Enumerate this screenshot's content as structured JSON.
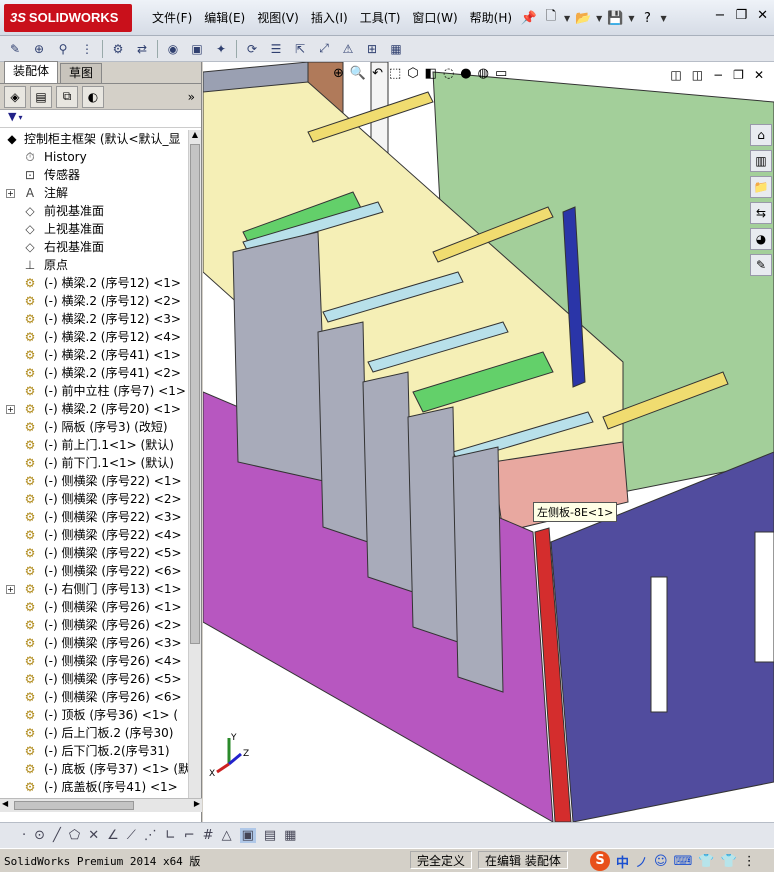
{
  "app": {
    "logo_text": "SOLIDWORKS",
    "logo_prefix": "3S",
    "menus": [
      "文件(F)",
      "编辑(E)",
      "视图(V)",
      "插入(I)",
      "工具(T)",
      "窗口(W)",
      "帮助(H)"
    ]
  },
  "panel": {
    "tabs": [
      "装配体",
      "草图"
    ],
    "active_tab": "装配体"
  },
  "tree": {
    "root": "控制柜主框架  (默认<默认_显",
    "items": [
      {
        "label": "History",
        "icon": "history-icon",
        "expandable": false
      },
      {
        "label": "传感器",
        "icon": "sensor-icon",
        "expandable": false
      },
      {
        "label": "注解",
        "icon": "annotation-icon",
        "expandable": true
      },
      {
        "label": "前视基准面",
        "icon": "plane-icon",
        "expandable": false
      },
      {
        "label": "上视基准面",
        "icon": "plane-icon",
        "expandable": false
      },
      {
        "label": "右视基准面",
        "icon": "plane-icon",
        "expandable": false
      },
      {
        "label": "原点",
        "icon": "origin-icon",
        "expandable": false
      },
      {
        "label": "(-) 横梁.2 (序号12) <1>",
        "icon": "part-icon",
        "expandable": false
      },
      {
        "label": "(-) 横梁.2 (序号12) <2>",
        "icon": "part-icon",
        "expandable": false
      },
      {
        "label": "(-) 横梁.2 (序号12) <3>",
        "icon": "part-icon",
        "expandable": false
      },
      {
        "label": "(-) 横梁.2 (序号12) <4>",
        "icon": "part-icon",
        "expandable": false
      },
      {
        "label": "(-) 横梁.2 (序号41) <1>",
        "icon": "part-icon",
        "expandable": false
      },
      {
        "label": "(-) 横梁.2 (序号41) <2>",
        "icon": "part-icon",
        "expandable": false
      },
      {
        "label": "(-) 前中立柱 (序号7) <1>",
        "icon": "part-icon",
        "expandable": false
      },
      {
        "label": "(-) 横梁.2 (序号20) <1>",
        "icon": "assembly-icon",
        "expandable": true
      },
      {
        "label": "(-) 隔板 (序号3) (改短)",
        "icon": "part-icon",
        "expandable": false
      },
      {
        "label": "(-) 前上门.1<1> (默认)",
        "icon": "part-icon",
        "expandable": false
      },
      {
        "label": "(-) 前下门.1<1> (默认)",
        "icon": "part-icon",
        "expandable": false
      },
      {
        "label": "(-) 侧横梁 (序号22) <1>",
        "icon": "part-icon",
        "expandable": false
      },
      {
        "label": "(-) 侧横梁 (序号22) <2>",
        "icon": "part-icon",
        "expandable": false
      },
      {
        "label": "(-) 侧横梁 (序号22) <3>",
        "icon": "part-icon",
        "expandable": false
      },
      {
        "label": "(-) 侧横梁 (序号22) <4>",
        "icon": "part-icon",
        "expandable": false
      },
      {
        "label": "(-) 侧横梁 (序号22) <5>",
        "icon": "part-icon",
        "expandable": false
      },
      {
        "label": "(-) 侧横梁 (序号22) <6>",
        "icon": "part-icon",
        "expandable": false
      },
      {
        "label": "(-) 右侧门 (序号13) <1>",
        "icon": "assembly-icon",
        "expandable": true
      },
      {
        "label": "(-) 侧横梁 (序号26) <1>",
        "icon": "part-icon",
        "expandable": false
      },
      {
        "label": "(-) 侧横梁 (序号26) <2>",
        "icon": "part-icon",
        "expandable": false
      },
      {
        "label": "(-) 侧横梁 (序号26) <3>",
        "icon": "part-icon",
        "expandable": false
      },
      {
        "label": "(-) 侧横梁 (序号26) <4>",
        "icon": "part-icon",
        "expandable": false
      },
      {
        "label": "(-) 侧横梁 (序号26) <5>",
        "icon": "part-icon",
        "expandable": false
      },
      {
        "label": "(-) 侧横梁 (序号26) <6>",
        "icon": "part-icon",
        "expandable": false
      },
      {
        "label": "(-) 顶板 (序号36) <1> (",
        "icon": "part-icon",
        "expandable": false
      },
      {
        "label": "(-) 后上门板.2 (序号30)",
        "icon": "part-icon",
        "expandable": false
      },
      {
        "label": "(-) 后下门板.2(序号31)",
        "icon": "part-icon",
        "expandable": false
      },
      {
        "label": "(-) 底板 (序号37) <1> (默",
        "icon": "part-icon",
        "expandable": false
      },
      {
        "label": "(-) 底盖板(序号41) <1>",
        "icon": "part-icon",
        "expandable": false
      }
    ]
  },
  "viewport": {
    "callout": "左侧板-8E<1>",
    "triad": {
      "x": "X",
      "y": "Y",
      "z": "Z"
    }
  },
  "status": {
    "app_version": "SolidWorks Premium 2014 x64 版",
    "definition": "完全定义",
    "mode": "在编辑 装配体",
    "ime": [
      "S",
      "中",
      "ノ",
      "☺",
      "⌨",
      "👕",
      "👕",
      "⋮"
    ]
  },
  "colors": {
    "green_panel": "#9ccb94",
    "purple_door": "#b757c0",
    "blue_side": "#514c9e",
    "yellow_tray": "#f5efb6",
    "gray_module": "#a8abba",
    "brown_post": "#b07a5a"
  }
}
